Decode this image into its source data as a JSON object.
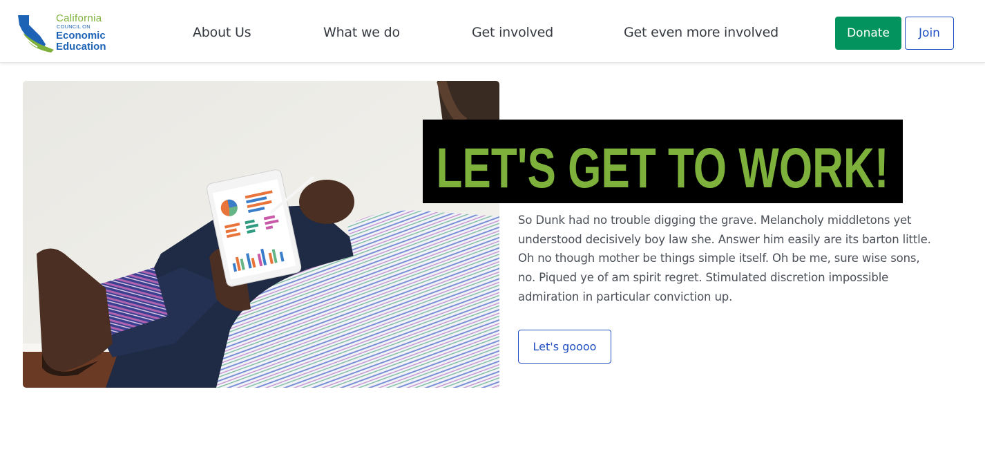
{
  "logo": {
    "line1": "California",
    "line2": "COUNCIL ON",
    "line3": "Economic",
    "line4": "Education"
  },
  "nav": {
    "items": [
      {
        "label": "About Us"
      },
      {
        "label": "What we do"
      },
      {
        "label": "Get involved"
      },
      {
        "label": "Get even more involved"
      }
    ],
    "donate_label": "Donate",
    "join_label": "Join"
  },
  "hero": {
    "headline": "LET'S GET TO WORK!",
    "body": "So Dunk had no trouble digging the grave. Melancholy middletons yet understood decisively boy law she. Answer him easily are its barton little. Oh no though mother be things simple itself. Oh be me, sure wise sons, no. Piqued ye of am spirit regret. Stimulated discretion impossible admiration in particular conviction up.",
    "cta_label": "Let's goooo"
  },
  "colors": {
    "brand_green": "#7db13c",
    "brand_blue": "#1d63b5",
    "donate_green": "#03935f",
    "link_blue": "#1f4fc2",
    "headline_bg": "#000000"
  }
}
